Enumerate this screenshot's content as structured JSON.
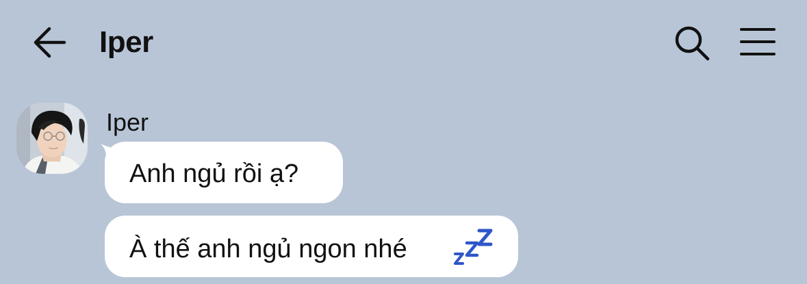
{
  "header": {
    "title": "Iper",
    "back_icon": "arrow-left-icon",
    "search_icon": "search-icon",
    "menu_icon": "hamburger-menu-icon"
  },
  "messages": {
    "sender_name": "Iper",
    "avatar": "profile-photo",
    "items": [
      {
        "text": "Anh ngủ rồi ạ?"
      },
      {
        "text": "À thế anh ngủ ngon nhé",
        "emoji": "zzz-sleeping-emoji"
      }
    ]
  },
  "colors": {
    "background": "#b8c5d7",
    "bubble": "#ffffff",
    "text": "#111111",
    "emoji": "#2f56c9"
  }
}
